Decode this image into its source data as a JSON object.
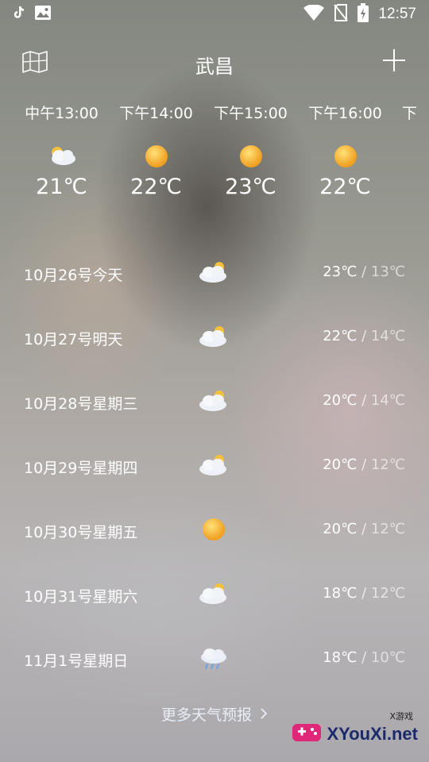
{
  "status_bar": {
    "time": "12:57",
    "icons": [
      "tiktok-icon",
      "image-icon",
      "wifi-icon",
      "no-sim-icon",
      "battery-charging-icon"
    ]
  },
  "header": {
    "title": "武昌",
    "left_icon": "map-icon",
    "right_icon": "add-icon"
  },
  "hourly": [
    {
      "time": "中午13:00",
      "icon": "cloudy-icon",
      "temp": "21℃"
    },
    {
      "time": "下午14:00",
      "icon": "sunny-icon",
      "temp": "22℃"
    },
    {
      "time": "下午15:00",
      "icon": "sunny-icon",
      "temp": "23℃"
    },
    {
      "time": "下午16:00",
      "icon": "sunny-icon",
      "temp": "22℃"
    },
    {
      "time": "下",
      "icon": "",
      "temp": ""
    }
  ],
  "daily": [
    {
      "date": "10月26号今天",
      "icon": "cloudy-icon",
      "high": "23℃",
      "sep": " / ",
      "low": "13℃"
    },
    {
      "date": "10月27号明天",
      "icon": "cloudy-icon",
      "high": "22℃",
      "sep": " / ",
      "low": "14℃"
    },
    {
      "date": "10月28号星期三",
      "icon": "cloudy-icon",
      "high": "20℃",
      "sep": " / ",
      "low": "14℃"
    },
    {
      "date": "10月29号星期四",
      "icon": "cloudy-icon",
      "high": "20℃",
      "sep": " / ",
      "low": "12℃"
    },
    {
      "date": "10月30号星期五",
      "icon": "sunny-icon",
      "high": "20℃",
      "sep": " / ",
      "low": "12℃"
    },
    {
      "date": "10月31号星期六",
      "icon": "cloudy-icon",
      "high": "18℃",
      "sep": " / ",
      "low": "12℃"
    },
    {
      "date": "11月1号星期日",
      "icon": "rain-icon",
      "high": "18℃",
      "sep": " / ",
      "low": "10℃"
    }
  ],
  "more_label": "更多天气预报",
  "watermark": {
    "top": "X游戏",
    "main": "XYouXi.net"
  }
}
